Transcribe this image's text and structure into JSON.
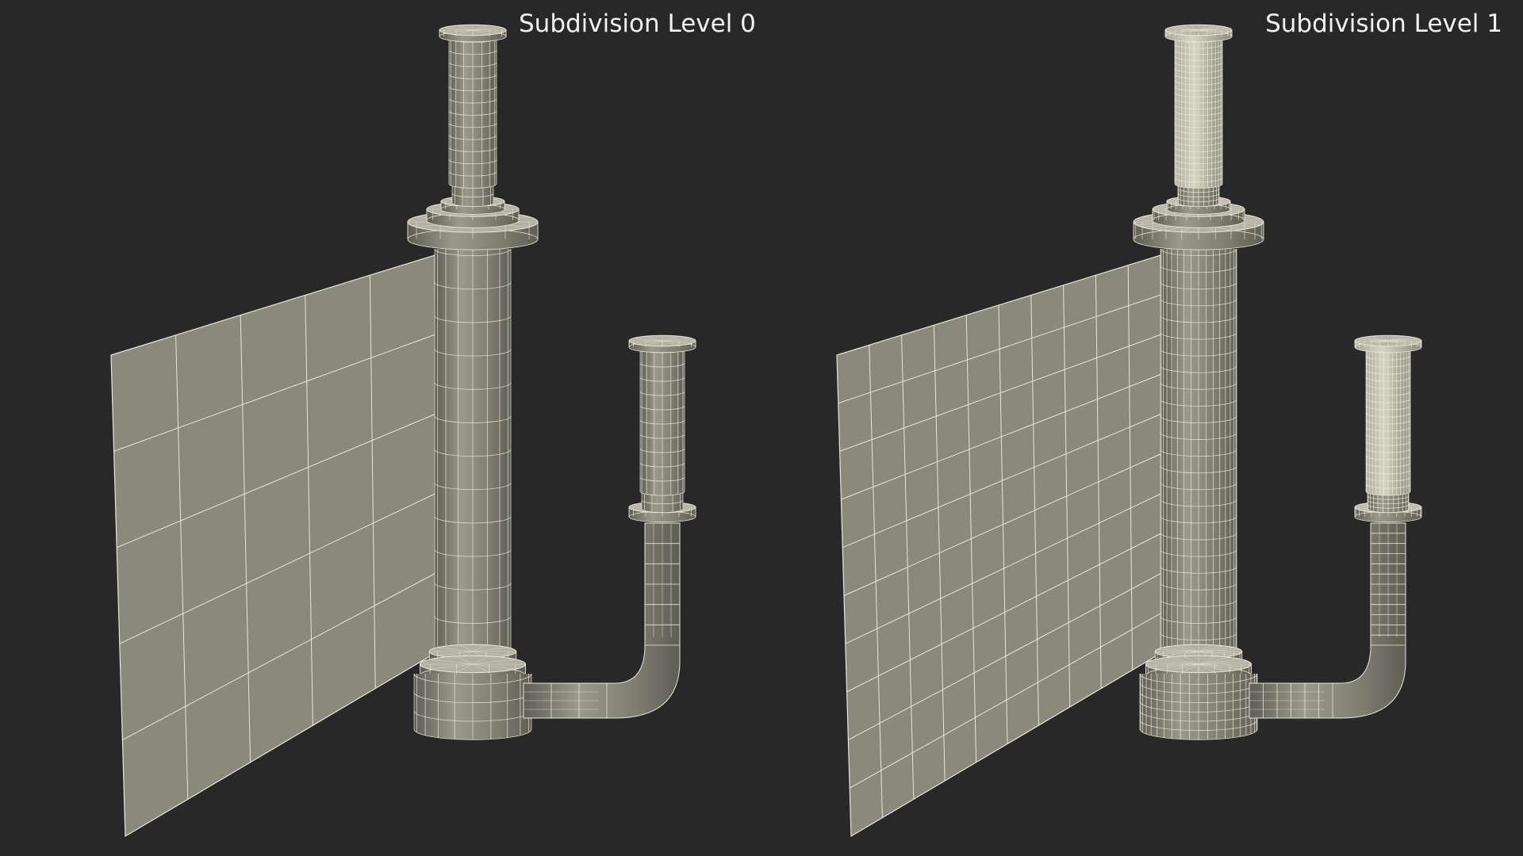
{
  "labels": {
    "left": "Subdivision Level 0",
    "right": "Subdivision Level 1"
  },
  "colors": {
    "background": "#282828",
    "text": "#f2f2f2",
    "surface": "#7f7f72",
    "surface_light": "#9a9a8c",
    "surface_dark": "#5e5e54",
    "wire": "#e9e6d6"
  },
  "models": {
    "left": {
      "subdivision_level": 0,
      "density": 1
    },
    "right": {
      "subdivision_level": 1,
      "density": 2
    }
  }
}
